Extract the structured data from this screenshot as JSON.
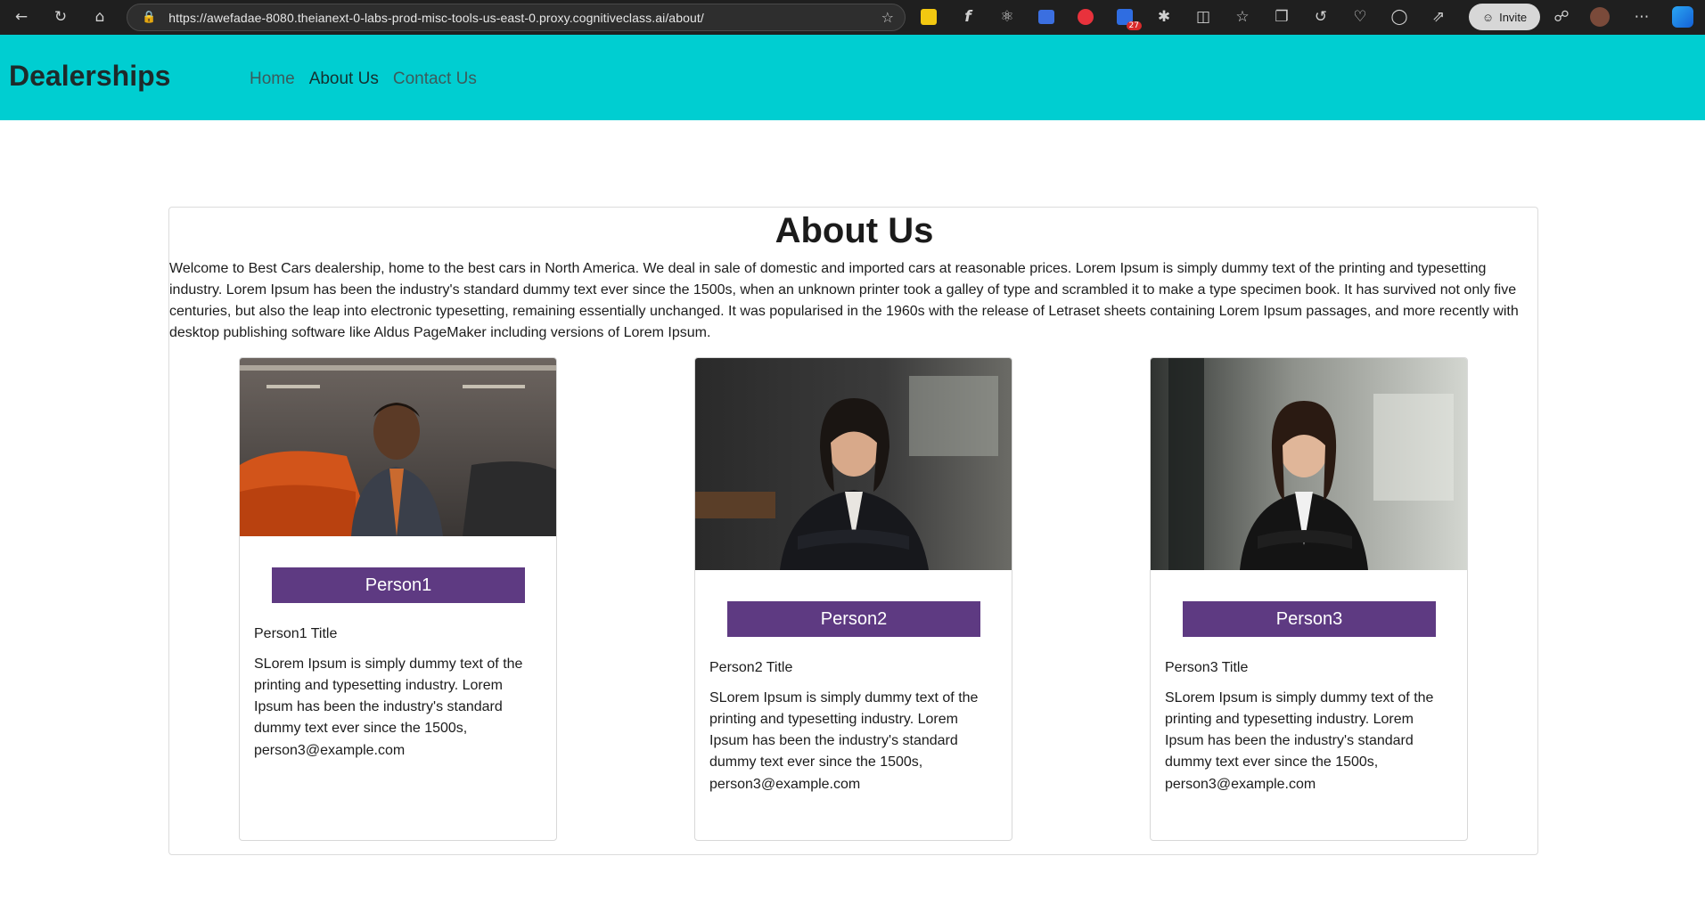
{
  "browser": {
    "url": "https://awefadae-8080.theianext-0-labs-prod-misc-tools-us-east-0.proxy.cognitiveclass.ai/about/",
    "invite_label": "Invite",
    "calendar_badge": "27"
  },
  "site": {
    "brand": "Dealerships",
    "nav": [
      {
        "label": "Home"
      },
      {
        "label": "About Us"
      },
      {
        "label": "Contact Us"
      }
    ]
  },
  "about": {
    "heading": "About Us",
    "text": "Welcome to Best Cars dealership, home to the best cars in North America. We deal in sale of domestic and imported cars at reasonable prices. Lorem Ipsum is simply dummy text of the printing and typesetting industry. Lorem Ipsum has been the industry's standard dummy text ever since the 1500s, when an unknown printer took a galley of type and scrambled it to make a type specimen book. It has survived not only five centuries, but also the leap into electronic typesetting, remaining essentially unchanged. It was popularised in the 1960s with the release of Letraset sheets containing Lorem Ipsum passages, and more recently with desktop publishing software like Aldus PageMaker including versions of Lorem Ipsum."
  },
  "people": [
    {
      "name": "Person1",
      "title": "Person1 Title",
      "description": "SLorem Ipsum is simply dummy text of the printing and typesetting industry. Lorem Ipsum has been the industry's standard dummy text ever since the 1500s,",
      "email": "person3@example.com"
    },
    {
      "name": "Person2",
      "title": "Person2 Title",
      "description": "SLorem Ipsum is simply dummy text of the printing and typesetting industry. Lorem Ipsum has been the industry's standard dummy text ever since the 1500s,",
      "email": "person3@example.com"
    },
    {
      "name": "Person3",
      "title": "Person3 Title",
      "description": "SLorem Ipsum is simply dummy text of the printing and typesetting industry. Lorem Ipsum has been the industry's standard dummy text ever since the 1500s,",
      "email": "person3@example.com"
    }
  ],
  "colors": {
    "header_bg": "#00ced1",
    "name_bar": "#5e3a82"
  }
}
